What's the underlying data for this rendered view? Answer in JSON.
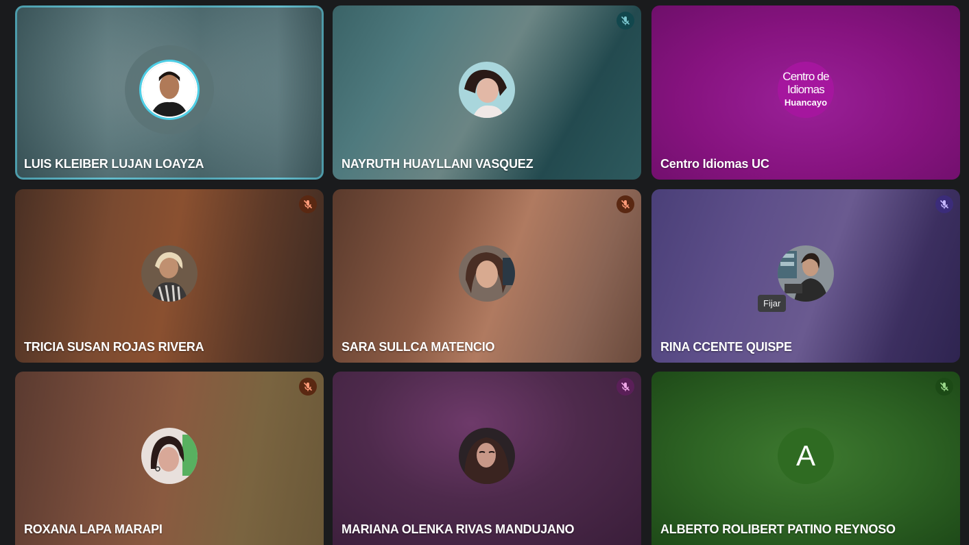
{
  "participants": [
    {
      "name": "LUIS KLEIBER LUJAN LOAYZA",
      "muted": false,
      "speaking": true,
      "avatar_icon": "person-photo"
    },
    {
      "name": "NAYRUTH HUAYLLANI VASQUEZ",
      "muted": true,
      "speaking": false,
      "avatar_icon": "person-photo"
    },
    {
      "name": "Centro Idiomas UC",
      "muted": false,
      "speaking": false,
      "avatar_icon": "logo",
      "logo": {
        "line1": "Centro de",
        "line2": "Idiomas",
        "line3": "Huancayo"
      }
    },
    {
      "name": "TRICIA SUSAN ROJAS RIVERA",
      "muted": true,
      "speaking": false,
      "avatar_icon": "person-photo"
    },
    {
      "name": "SARA SULLCA MATENCIO",
      "muted": true,
      "speaking": false,
      "avatar_icon": "person-photo"
    },
    {
      "name": "RINA CCENTE QUISPE",
      "muted": true,
      "speaking": false,
      "avatar_icon": "person-photo"
    },
    {
      "name": "ROXANA LAPA MARAPI",
      "muted": true,
      "speaking": false,
      "avatar_icon": "person-photo"
    },
    {
      "name": "MARIANA OLENKA RIVAS MANDUJANO",
      "muted": true,
      "speaking": false,
      "avatar_icon": "person-photo"
    },
    {
      "name": "ALBERTO ROLIBERT PATINO REYNOSO",
      "muted": true,
      "speaking": false,
      "avatar_icon": "letter-avatar",
      "initial": "A"
    }
  ],
  "tooltip": {
    "text": "Fijar"
  },
  "colors": {
    "speaking_border": "#5fd0e6",
    "background": "#1a1b1d"
  }
}
